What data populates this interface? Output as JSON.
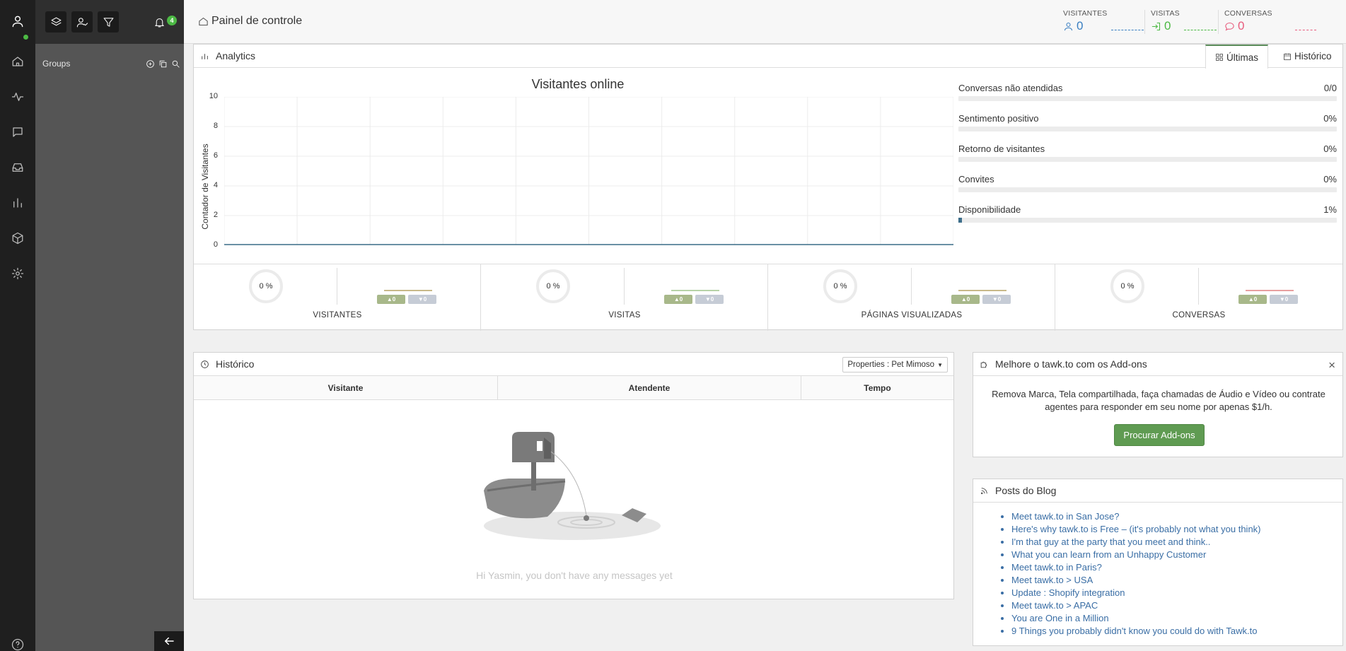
{
  "header": {
    "title": "Painel de controle",
    "stats": [
      {
        "label": "VISITANTES",
        "value": "0",
        "icon": "user-icon",
        "color": "#3a7fc2"
      },
      {
        "label": "VISITAS",
        "value": "0",
        "icon": "sign-in-icon",
        "color": "#4cb944"
      },
      {
        "label": "CONVERSAS",
        "value": "0",
        "icon": "chat-bubble-icon",
        "color": "#e85c7d"
      }
    ]
  },
  "sidebar": {
    "groups_label": "Groups",
    "notifications_count": "4"
  },
  "analytics": {
    "title": "Analytics",
    "tabs": [
      {
        "label": "Últimas",
        "active": true
      },
      {
        "label": "Histórico",
        "active": false
      }
    ],
    "metrics": [
      {
        "label": "Conversas não atendidas",
        "value": "0/0",
        "fill": 0
      },
      {
        "label": "Sentimento positivo",
        "value": "0%",
        "fill": 0
      },
      {
        "label": "Retorno de visitantes",
        "value": "0%",
        "fill": 0
      },
      {
        "label": "Convites",
        "value": "0%",
        "fill": 0
      },
      {
        "label": "Disponibilidade",
        "value": "1%",
        "fill": 0.01
      }
    ],
    "kpis": [
      {
        "name": "VISITANTES",
        "percent": "0 %",
        "up": "0",
        "down": "0",
        "trend_color": "#c8b98a"
      },
      {
        "name": "VISITAS",
        "percent": "0 %",
        "up": "0",
        "down": "0",
        "trend_color": "#b7d3a8"
      },
      {
        "name": "PÁGINAS VISUALIZADAS",
        "percent": "0 %",
        "up": "0",
        "down": "0",
        "trend_color": "#c8b98a"
      },
      {
        "name": "CONVERSAS",
        "percent": "0 %",
        "up": "0",
        "down": "0",
        "trend_color": "#e8a0a0"
      }
    ]
  },
  "chart_data": {
    "type": "line",
    "title": "Visitantes online",
    "xlabel": "",
    "ylabel": "Contador de Visitantes",
    "ylim": [
      0,
      10
    ],
    "yticks": [
      "10",
      "8",
      "6",
      "4",
      "2",
      "0"
    ],
    "x": [
      0,
      1,
      2,
      3,
      4,
      5,
      6,
      7,
      8,
      9,
      10
    ],
    "series": [
      {
        "values": [
          0,
          0,
          0,
          0,
          0,
          0,
          0,
          0,
          0,
          0,
          0
        ],
        "color": "#3d6e8a"
      }
    ],
    "grid": true
  },
  "history": {
    "title": "Histórico",
    "filter": "Properties : Pet Mimoso",
    "columns": [
      "Visitante",
      "Atendente",
      "Tempo"
    ],
    "empty_message": "Hi Yasmin, you don't have any messages yet"
  },
  "addons": {
    "title": "Melhore o tawk.to com os Add-ons",
    "description": "Remova Marca, Tela compartilhada, faça chamadas de Áudio e Vídeo ou contrate agentes para responder em seu nome por apenas $1/h.",
    "button": "Procurar Add-ons",
    "close": "×"
  },
  "blog": {
    "title": "Posts do Blog",
    "posts": [
      "Meet tawk.to in San Jose?",
      "Here's why tawk.to is Free – (it's probably not what you think)",
      "I'm that guy at the party that you meet and think..",
      "What you can learn from an Unhappy Customer",
      "Meet tawk.to in Paris?",
      "Meet tawk.to > USA",
      "Update : Shopify integration",
      "Meet tawk.to > APAC",
      "You are One in a Million",
      "9 Things you probably didn't know you could do with Tawk.to"
    ]
  },
  "colors": {
    "accent_green": "#5f9b52",
    "link_blue": "#3a6ea5",
    "sidebar_dark": "#1f1f1f"
  }
}
